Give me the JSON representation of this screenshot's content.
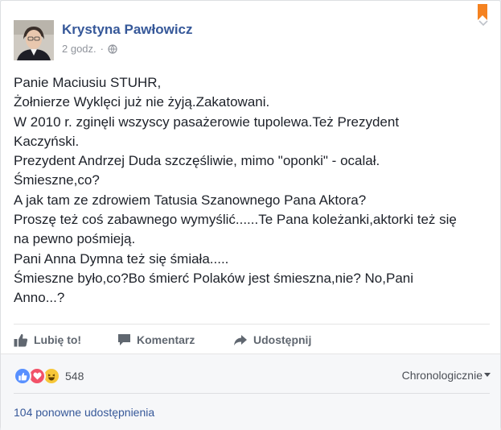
{
  "post": {
    "author": "Krystyna Pawłowicz",
    "time": "2 godz.",
    "time_sep": "·",
    "lines": [
      "Panie Maciusiu STUHR,",
      "Żołnierze Wyklęci już nie żyją.Zakatowani.",
      "W 2010 r. zginęli wszyscy pasażerowie tupolewa.Też Prezydent",
      "Kaczyński.",
      "Prezydent Andrzej Duda szczęśliwie, mimo \"oponki\" - ocalał.",
      "Śmieszne,co?",
      "A jak tam ze zdrowiem Tatusia Szanownego Pana Aktora?",
      "Proszę też coś zabawnego wymyślić......Te Pana koleżanki,aktorki też się",
      "na pewno pośmieją.",
      "Pani Anna Dymna też się śmiała.....",
      "Śmieszne było,co?Bo śmierć Polaków jest śmieszna,nie? No,Pani",
      "Anno...?"
    ]
  },
  "actions": {
    "like": "Lubię to!",
    "comment": "Komentarz",
    "share": "Udostępnij"
  },
  "reactions": {
    "count": "548",
    "icons": [
      "like-icon",
      "love-icon",
      "haha-icon"
    ]
  },
  "order": "Chronologicznie",
  "shares": "104 ponowne udostępnienia",
  "colors": {
    "link": "#365899",
    "like": "#5890ff",
    "love": "#f25268",
    "haha": "#f7c739",
    "bookmark": "#f58220"
  }
}
